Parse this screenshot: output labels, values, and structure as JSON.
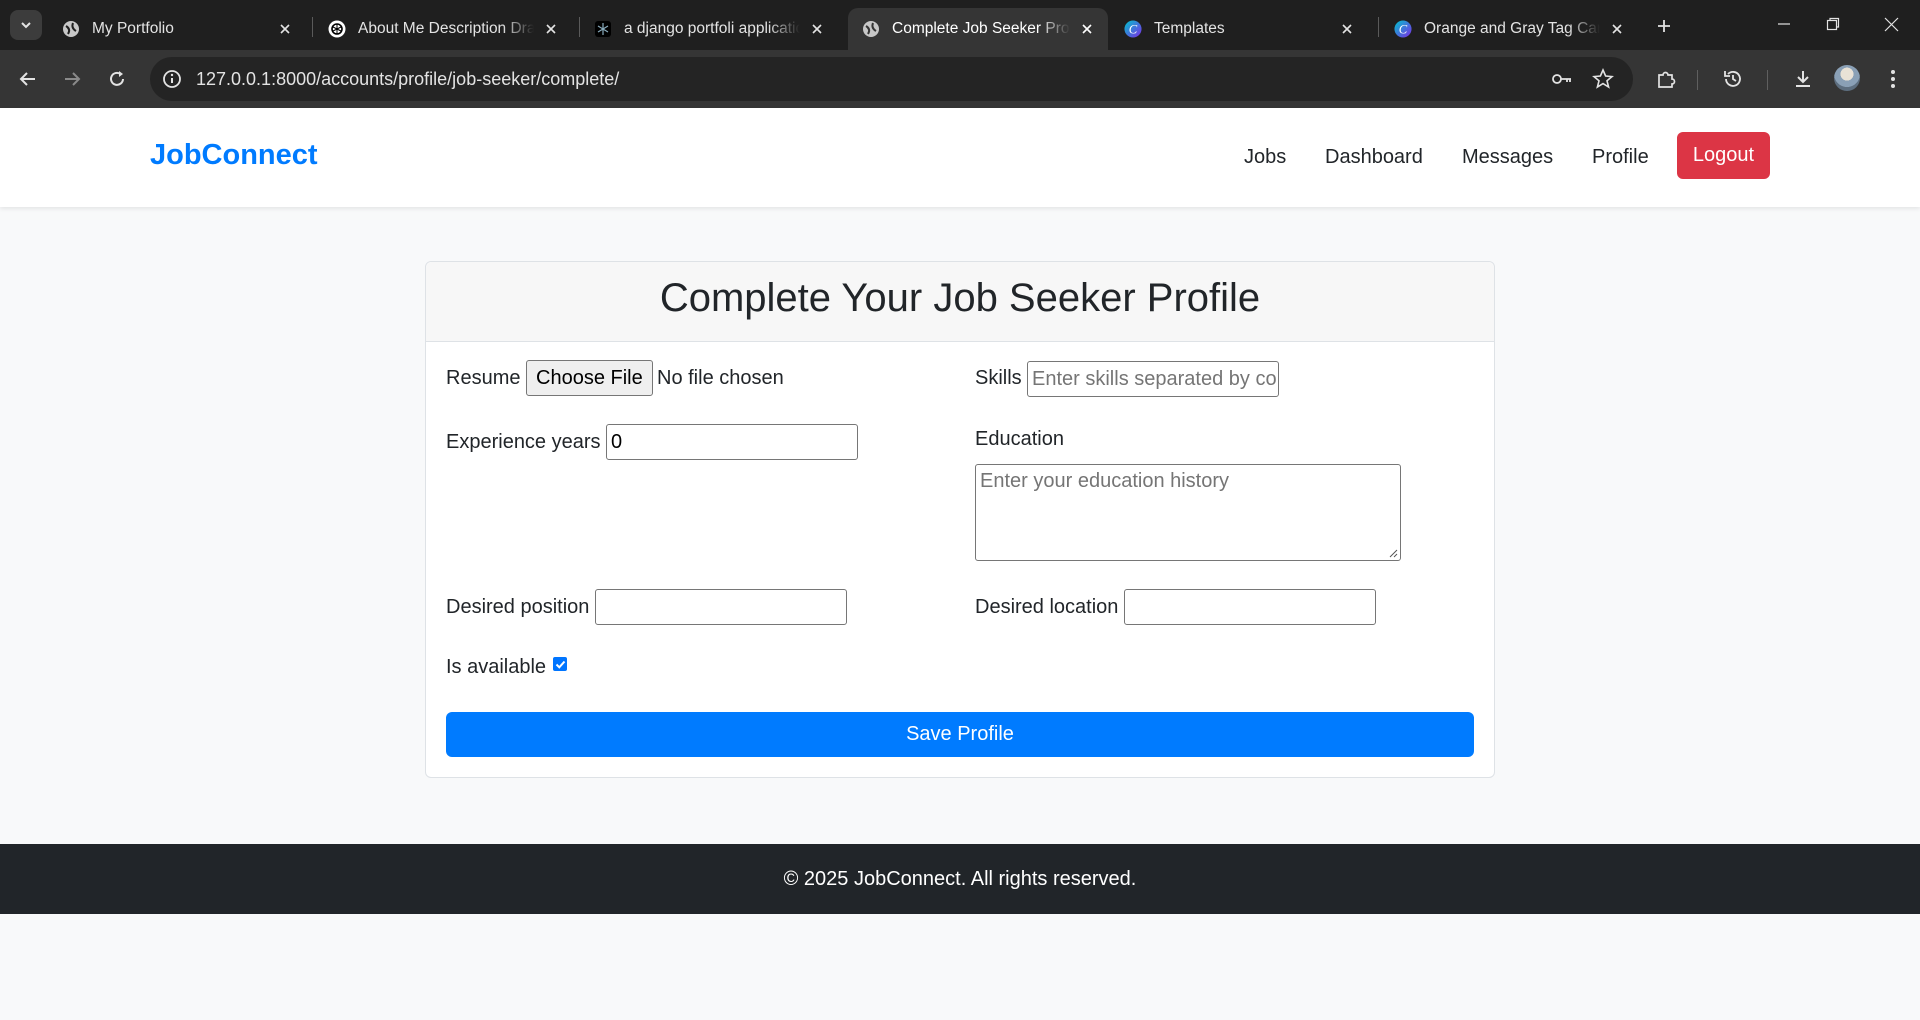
{
  "browser": {
    "tabs": [
      {
        "title": "My Portfolio",
        "icon": "globe-icon"
      },
      {
        "title": "About Me Description Draft",
        "icon": "chatgpt-icon"
      },
      {
        "title": "a django portfoli application",
        "icon": "perplexity-icon"
      },
      {
        "title": "Complete Job Seeker Profile",
        "icon": "globe-icon",
        "active": true
      },
      {
        "title": "Templates",
        "icon": "canva-icon"
      },
      {
        "title": "Orange and Gray Tag Cart",
        "icon": "canva-icon"
      }
    ],
    "url": "127.0.0.1:8000/accounts/profile/job-seeker/complete/"
  },
  "navbar": {
    "brand": "JobConnect",
    "links": [
      "Jobs",
      "Dashboard",
      "Messages",
      "Profile"
    ],
    "logout_label": "Logout"
  },
  "form": {
    "title": "Complete Your Job Seeker Profile",
    "resume_label": "Resume",
    "file_button": "Choose File",
    "file_status": "No file chosen",
    "skills_label": "Skills",
    "skills_placeholder": "Enter skills separated by co",
    "experience_label": "Experience years",
    "experience_value": "0",
    "education_label": "Education",
    "education_placeholder": "Enter your education history",
    "position_label": "Desired position",
    "position_value": "",
    "location_label": "Desired location",
    "location_value": "",
    "available_label": "Is available",
    "available_checked": true,
    "save_label": "Save Profile"
  },
  "footer": {
    "text": "© 2025 JobConnect. All rights reserved."
  },
  "colors": {
    "brand": "#007bff",
    "logout": "#dc3545",
    "footer_bg": "#212529",
    "chrome_bg": "#1f1f1f"
  }
}
